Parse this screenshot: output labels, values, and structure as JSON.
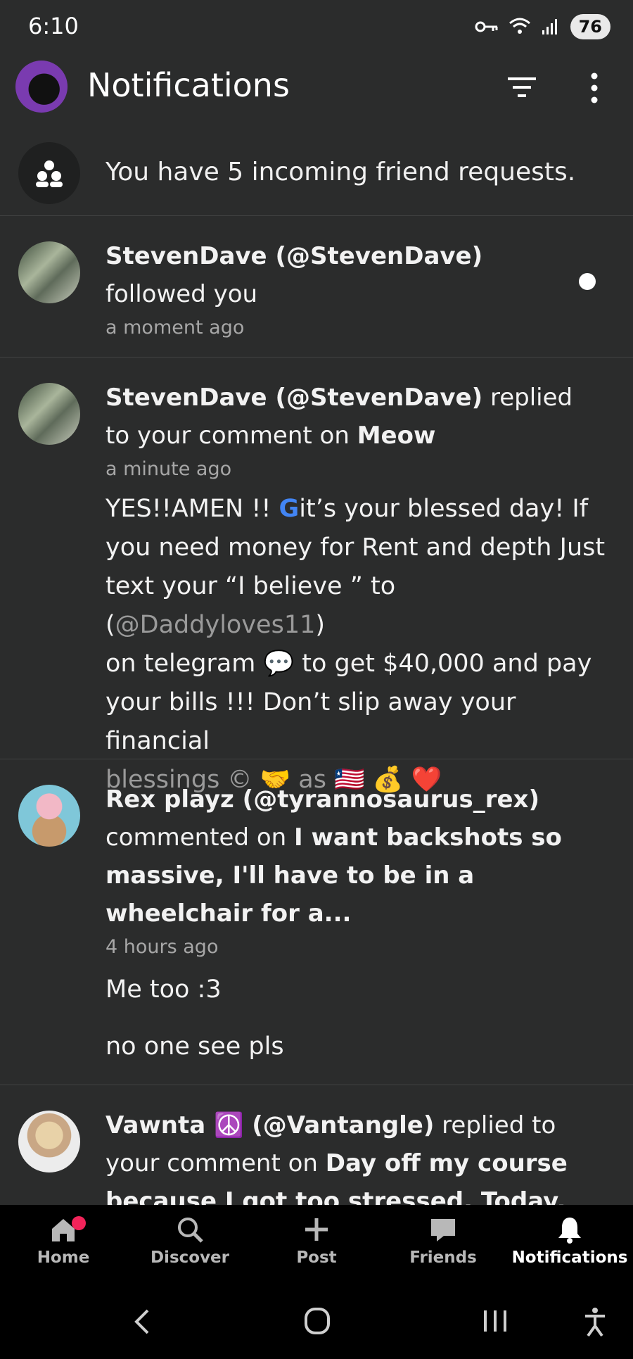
{
  "status_bar": {
    "time": "6:10",
    "battery": "76"
  },
  "header": {
    "title": "Notifications"
  },
  "friend_requests": {
    "text": "You have 5 incoming friend requests."
  },
  "notifications": [
    {
      "user": "StevenDave (@StevenDave)",
      "action": "followed you",
      "time": "a moment ago",
      "unread": true
    },
    {
      "user": "StevenDave (@StevenDave)",
      "action_pre": " replied",
      "action_line2": "to your comment on ",
      "post": "Meow",
      "time": "a minute ago",
      "message_lines": [
        "YES!!AMEN !! ",
        "it’s your blessed day! If",
        "you need money for Rent and depth  Just",
        "text your “I believe ” to (",
        "@Daddyloves11",
        ")",
        "on telegram ",
        " to get $40,000 and pay",
        "your bills !!! Don’t slip away your financial",
        "blessings © ",
        " as "
      ],
      "emojis": {
        "g": "G",
        "speech": "💬",
        "handshake": "🤝",
        "flag": "🇱🇷",
        "money": "💰",
        "heart": "❤️"
      }
    },
    {
      "user": "Rex playz (@tyrannosaurus_rex)",
      "action": "commented on ",
      "post_lines": [
        "I want backshots so",
        "massive, I'll have to be in a",
        "wheelchair for a..."
      ],
      "time": "4 hours ago",
      "replies": [
        "Me too :3",
        "no one see pls"
      ]
    },
    {
      "user_name": "Vawnta ",
      "user_emoji": "☮️",
      "user_handle": " (@Vantangle)",
      "action": " replied to",
      "action_line2": "your comment on ",
      "post_line1": "Day off my course",
      "post_line2": "because I got too stressed. Today,"
    }
  ],
  "bottom_nav": [
    {
      "label": "Home",
      "icon": "home-icon"
    },
    {
      "label": "Discover",
      "icon": "search-icon"
    },
    {
      "label": "Post",
      "icon": "plus-icon"
    },
    {
      "label": "Friends",
      "icon": "chat-bubble-icon"
    },
    {
      "label": "Notifications",
      "icon": "bell-icon",
      "active": true
    }
  ],
  "colors": {
    "background": "#2b2c2c",
    "badge": "#f2245a",
    "nav": "#000000"
  }
}
